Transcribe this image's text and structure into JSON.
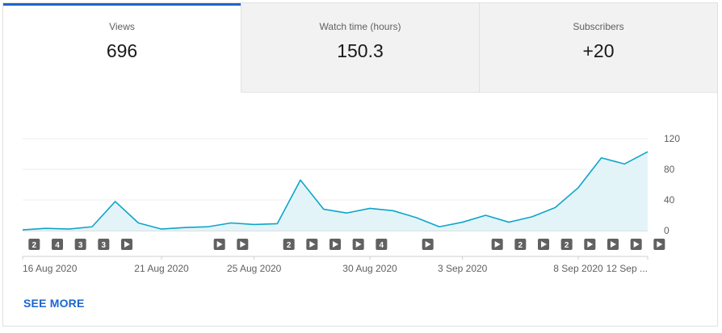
{
  "tabs": [
    {
      "label": "Views",
      "value": "696"
    },
    {
      "label": "Watch time (hours)",
      "value": "150.3"
    },
    {
      "label": "Subscribers",
      "value": "+20"
    }
  ],
  "see_more": "SEE MORE",
  "colors": {
    "accent": "#1a66d0",
    "line": "#0ea5c9",
    "area": "#e3f4f9",
    "marker": "#616161"
  },
  "chart_data": {
    "type": "area",
    "x": [
      "15 Aug",
      "16 Aug",
      "17 Aug",
      "18 Aug",
      "19 Aug",
      "20 Aug",
      "21 Aug",
      "22 Aug",
      "23 Aug",
      "24 Aug",
      "25 Aug",
      "26 Aug",
      "27 Aug",
      "28 Aug",
      "29 Aug",
      "30 Aug",
      "31 Aug",
      "1 Sep",
      "2 Sep",
      "3 Sep",
      "4 Sep",
      "5 Sep",
      "6 Sep",
      "7 Sep",
      "8 Sep",
      "9 Sep",
      "10 Sep",
      "11 Sep",
      "12 Sep"
    ],
    "values": [
      1,
      3,
      2,
      5,
      38,
      10,
      2,
      4,
      5,
      10,
      8,
      9,
      66,
      28,
      23,
      29,
      26,
      17,
      5,
      11,
      20,
      11,
      18,
      30,
      56,
      95,
      87,
      103
    ],
    "xlabels": [
      "16 Aug 2020",
      "21 Aug 2020",
      "25 Aug 2020",
      "30 Aug 2020",
      "3 Sep 2020",
      "8 Sep 2020",
      "12 Sep ..."
    ],
    "yticks": [
      "0",
      "40",
      "80",
      "120"
    ],
    "ylim": [
      0,
      120
    ],
    "grid": true,
    "markers": [
      "2",
      "4",
      "3",
      "3",
      "▶",
      "",
      "",
      "",
      "▶",
      "▶",
      "",
      "2",
      "▶",
      "▶",
      "▶",
      "4",
      "",
      "▶",
      "",
      "",
      "▶",
      "2",
      "▶",
      "2",
      "▶",
      "▶",
      "▶",
      "▶"
    ]
  }
}
